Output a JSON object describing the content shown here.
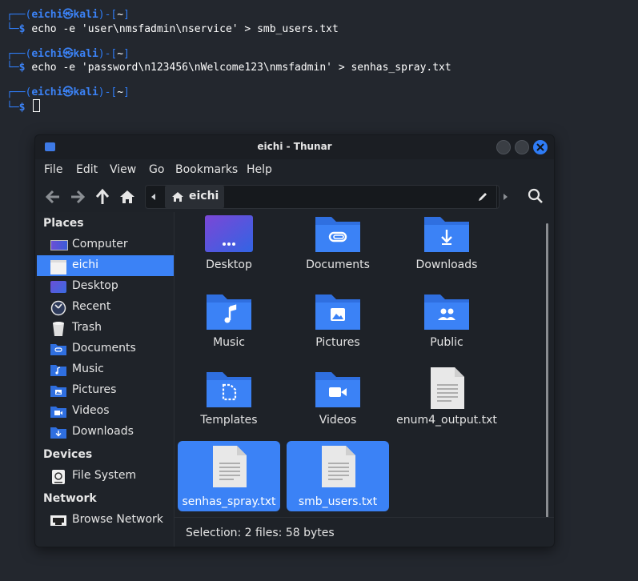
{
  "terminal": {
    "lines": [
      {
        "prompt_user": "eichi",
        "prompt_sym": "㉿",
        "prompt_host": "kali",
        "prompt_dir": "~",
        "command": "echo -e 'user\\nmsfadmin\\nservice' > smb_users.txt"
      },
      {
        "prompt_user": "eichi",
        "prompt_sym": "㉿",
        "prompt_host": "kali",
        "prompt_dir": "~",
        "command": "echo -e 'password\\n123456\\nWelcome123\\nmsfadmin' > senhas_spray.txt"
      },
      {
        "prompt_user": "eichi",
        "prompt_sym": "㉿",
        "prompt_host": "kali",
        "prompt_dir": "~",
        "command": ""
      }
    ]
  },
  "window": {
    "title": "eichi - Thunar",
    "menu": [
      "File",
      "Edit",
      "View",
      "Go",
      "Bookmarks",
      "Help"
    ],
    "path_current": "eichi"
  },
  "sidebar": {
    "places_heading": "Places",
    "places": [
      {
        "label": "Computer",
        "icon": "computer-icon"
      },
      {
        "label": "eichi",
        "icon": "home-folder-icon",
        "selected": true
      },
      {
        "label": "Desktop",
        "icon": "desktop-icon"
      },
      {
        "label": "Recent",
        "icon": "recent-icon"
      },
      {
        "label": "Trash",
        "icon": "trash-icon"
      },
      {
        "label": "Documents",
        "icon": "documents-folder-icon"
      },
      {
        "label": "Music",
        "icon": "music-folder-icon"
      },
      {
        "label": "Pictures",
        "icon": "pictures-folder-icon"
      },
      {
        "label": "Videos",
        "icon": "videos-folder-icon"
      },
      {
        "label": "Downloads",
        "icon": "downloads-folder-icon"
      }
    ],
    "devices_heading": "Devices",
    "devices": [
      {
        "label": "File System",
        "icon": "drive-icon"
      }
    ],
    "network_heading": "Network",
    "network": [
      {
        "label": "Browse Network",
        "icon": "network-icon"
      }
    ]
  },
  "files": [
    {
      "name": "Desktop",
      "icon": "desktop-folder-icon"
    },
    {
      "name": "Documents",
      "icon": "documents-folder-icon"
    },
    {
      "name": "Downloads",
      "icon": "downloads-folder-icon"
    },
    {
      "name": "Music",
      "icon": "music-folder-icon"
    },
    {
      "name": "Pictures",
      "icon": "pictures-folder-icon"
    },
    {
      "name": "Public",
      "icon": "public-folder-icon"
    },
    {
      "name": "Templates",
      "icon": "templates-folder-icon"
    },
    {
      "name": "Videos",
      "icon": "videos-folder-icon"
    },
    {
      "name": "enum4_output.txt",
      "icon": "text-file-icon"
    },
    {
      "name": "senhas_spray.txt",
      "icon": "text-file-icon",
      "selected": true
    },
    {
      "name": "smb_users.txt",
      "icon": "text-file-icon",
      "selected": true
    }
  ],
  "status": {
    "text": "Selection: 2 files: 58 bytes"
  },
  "colors": {
    "accent": "#3b82f6",
    "folder": "#2f6fe0",
    "background": "#23272e"
  }
}
